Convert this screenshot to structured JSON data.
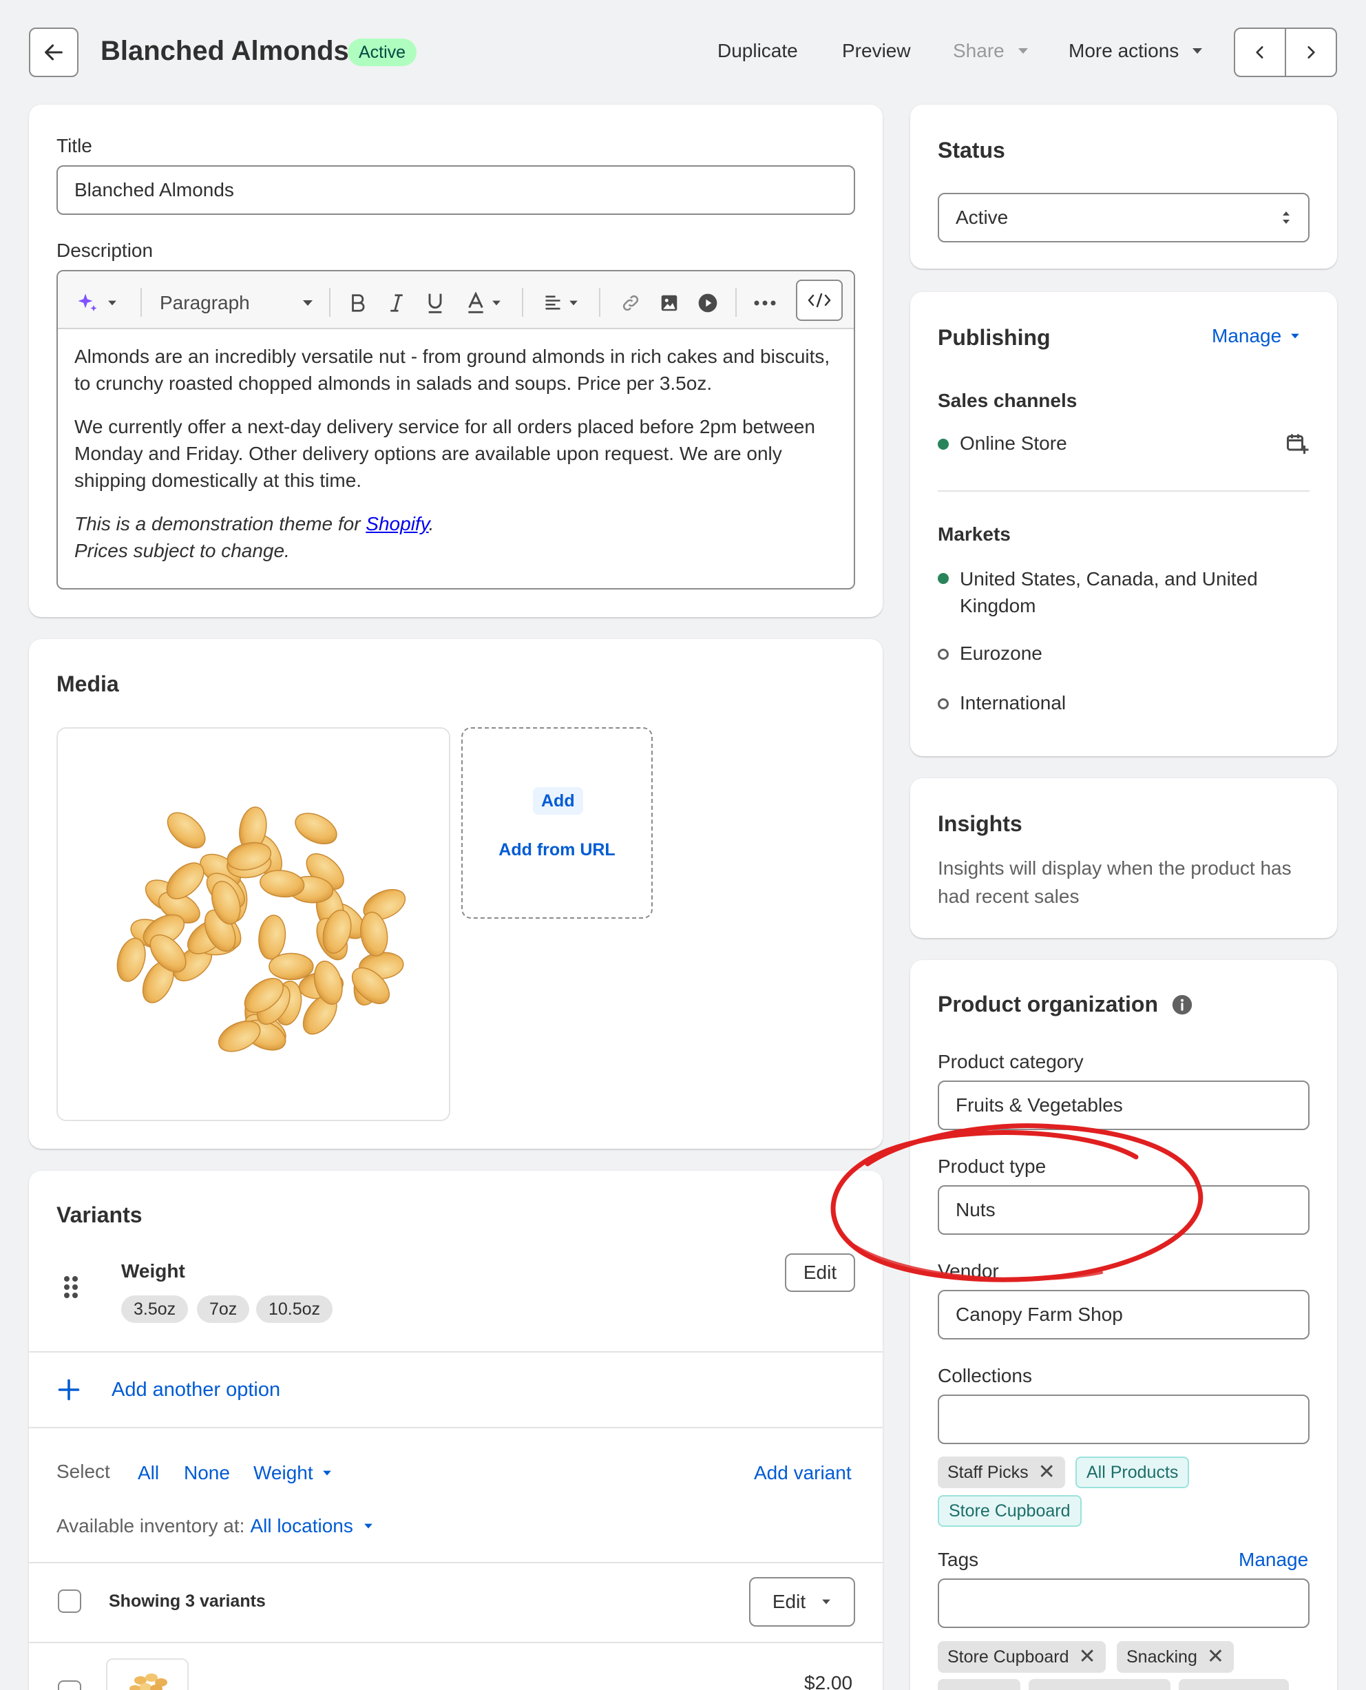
{
  "header": {
    "title": "Blanched Almonds",
    "badge": "Active",
    "actions": {
      "duplicate": "Duplicate",
      "preview": "Preview",
      "share": "Share",
      "more_actions": "More actions"
    }
  },
  "product": {
    "title_label": "Title",
    "title_value": "Blanched Almonds",
    "description_label": "Description",
    "format_select": "Paragraph",
    "description": {
      "p1": "Almonds are an incredibly versatile nut - from ground almonds in rich cakes and biscuits, to crunchy roasted chopped almonds in salads and soups. Price per 3.5oz.",
      "p2": "We currently offer a next-day delivery service for all orders placed before 2pm between Monday and Friday. Other delivery options are available upon request. We are only shipping domestically at this time.",
      "p3_prefix": "This is a demonstration theme for ",
      "p3_link": "Shopify",
      "p3_suffix": ".",
      "p4": "Prices subject to change."
    }
  },
  "media": {
    "heading": "Media",
    "add_label": "Add",
    "add_from_url": "Add from URL"
  },
  "variants": {
    "heading": "Variants",
    "option_name": "Weight",
    "option_values": [
      "3.5oz",
      "7oz",
      "10.5oz"
    ],
    "edit_label": "Edit",
    "add_another_option": "Add another option",
    "select_label": "Select",
    "select_all": "All",
    "select_none": "None",
    "select_weight": "Weight",
    "add_variant": "Add variant",
    "inventory_prefix": "Available inventory at:",
    "inventory_link": "All locations",
    "showing": "Showing 3 variants",
    "bulk_edit": "Edit",
    "first_price": "$2.00"
  },
  "status": {
    "heading": "Status",
    "value": "Active"
  },
  "publishing": {
    "heading": "Publishing",
    "manage": "Manage",
    "sales_channels_label": "Sales channels",
    "channel": "Online Store",
    "markets_label": "Markets",
    "market_1": "United States, Canada, and United Kingdom",
    "market_2": "Eurozone",
    "market_3": "International"
  },
  "insights": {
    "heading": "Insights",
    "text": "Insights will display when the product has had recent sales"
  },
  "organization": {
    "heading": "Product organization",
    "category_label": "Product category",
    "category_value": "Fruits & Vegetables",
    "type_label": "Product type",
    "type_value": "Nuts",
    "vendor_label": "Vendor",
    "vendor_value": "Canopy Farm Shop",
    "collections_label": "Collections",
    "collections": [
      "Staff Picks",
      "All Products",
      "Store Cupboard"
    ],
    "tags_label": "Tags",
    "tags_manage": "Manage",
    "tags": [
      "Store Cupboard",
      "Snacking"
    ]
  },
  "colors": {
    "accent": "#005bd3",
    "badge_bg": "#affebf",
    "badge_text": "#014b40",
    "annotation": "#e02020"
  }
}
